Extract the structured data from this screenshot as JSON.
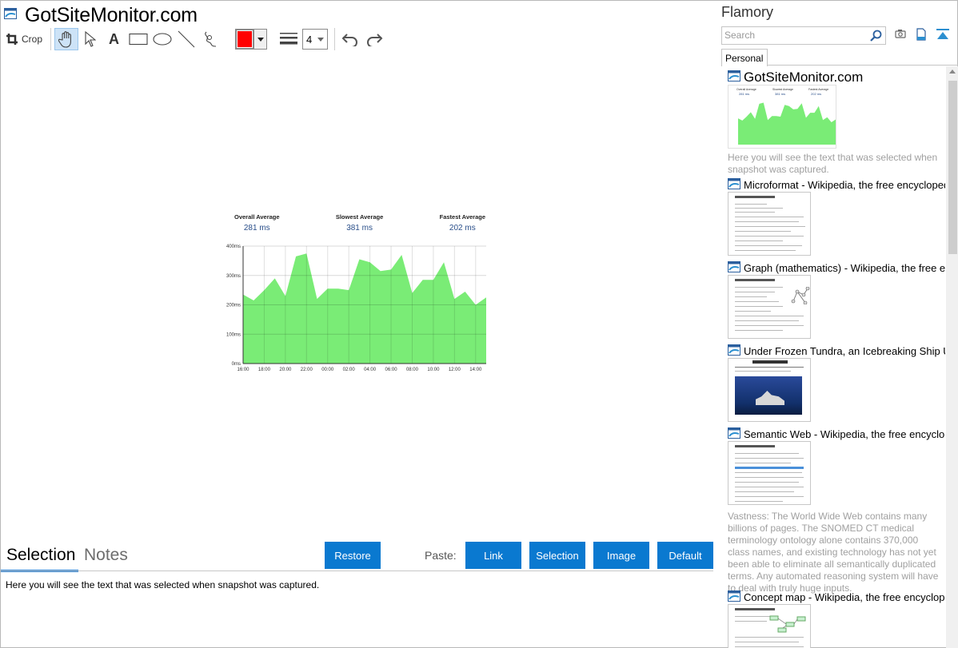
{
  "editor": {
    "title": "GotSiteMonitor.com",
    "toolbar": {
      "crop_label": "Crop",
      "line_width": "4",
      "active_color": "#ff0000",
      "tools": [
        "hand-icon",
        "pointer-icon",
        "text-icon",
        "rectangle-icon",
        "ellipse-icon",
        "line-icon",
        "freehand-icon"
      ]
    },
    "snapshot": {
      "stats": [
        {
          "label": "Overall Average",
          "value": "281 ms"
        },
        {
          "label": "Slowest Average",
          "value": "381 ms"
        },
        {
          "label": "Fastest Average",
          "value": "202 ms"
        }
      ]
    }
  },
  "chart_data": {
    "type": "area",
    "title": "",
    "xlabel": "",
    "ylabel": "",
    "ylim": [
      0,
      400
    ],
    "yticks": [
      "0ms",
      "100ms",
      "200ms",
      "300ms",
      "400ms"
    ],
    "xticks": [
      "16:00",
      "18:00",
      "20:00",
      "22:00",
      "00:00",
      "02:00",
      "04:00",
      "06:00",
      "08:00",
      "10:00",
      "12:00",
      "14:00"
    ],
    "values": [
      235,
      215,
      250,
      290,
      230,
      365,
      375,
      220,
      255,
      255,
      250,
      355,
      345,
      315,
      320,
      370,
      240,
      285,
      285,
      345,
      220,
      245,
      200,
      225
    ],
    "fill_color": "#7aec76",
    "grid": true
  },
  "bottom": {
    "tabs": [
      {
        "label": "Selection",
        "active": true
      },
      {
        "label": "Notes",
        "active": false
      }
    ],
    "restore_label": "Restore",
    "paste_label": "Paste:",
    "paste_buttons": [
      "Link",
      "Selection",
      "Image",
      "Default"
    ],
    "selection_text": "Here you will see the text that was selected when snapshot was captured."
  },
  "sidebar": {
    "app_name": "Flamory",
    "search_placeholder": "Search",
    "tab_label": "Personal",
    "entries": [
      {
        "title": "GotSiteMonitor.com",
        "desc": "Here you will see the text that was selected when snapshot was captured."
      },
      {
        "title": "Microformat - Wikipedia, the free encyclopedia",
        "desc": ""
      },
      {
        "title": "Graph (mathematics) - Wikipedia, the free encyclopedia",
        "desc": ""
      },
      {
        "title": "Under Frozen Tundra, an Icebreaking Ship Uncovers",
        "desc": ""
      },
      {
        "title": "Semantic Web - Wikipedia, the free encyclopedia",
        "desc": "Vastness: The World Wide Web contains many billions of pages. The SNOMED CT medical terminology ontology alone contains 370,000 class names, and existing technology has not yet been able to eliminate all semantically duplicated terms. Any automated reasoning system will have to deal with truly huge inputs."
      },
      {
        "title": "Concept map - Wikipedia, the free encyclopedia",
        "desc": ""
      }
    ]
  }
}
